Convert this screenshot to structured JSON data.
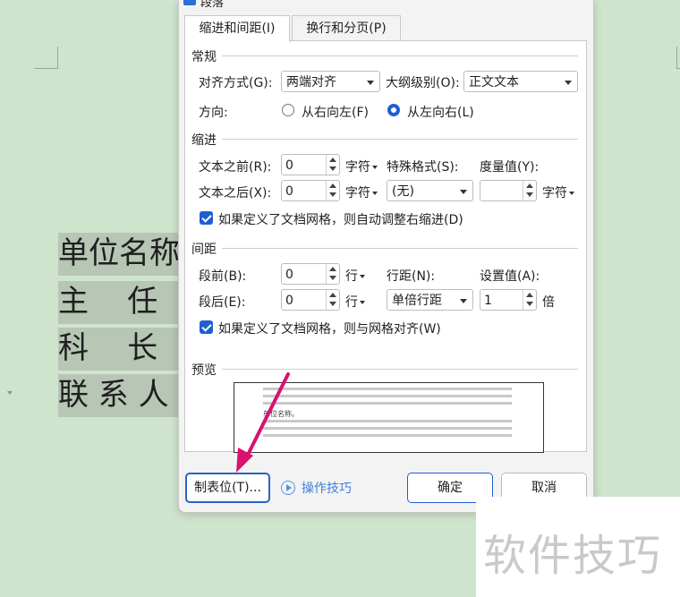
{
  "document": {
    "lines": [
      "单位名称",
      "主    任",
      "科    长",
      "联 系 人"
    ]
  },
  "dialog": {
    "title": "段落",
    "tabs": [
      "缩进和间距(I)",
      "换行和分页(P)"
    ],
    "general": {
      "section": "常规",
      "align_label": "对齐方式(G):",
      "align_value": "两端对齐",
      "outline_label": "大纲级别(O):",
      "outline_value": "正文文本",
      "direction_label": "方向:",
      "rtl_label": "从右向左(F)",
      "ltr_label": "从左向右(L)"
    },
    "indent": {
      "section": "缩进",
      "before_label": "文本之前(R):",
      "before_value": "0",
      "before_unit": "字符",
      "after_label": "文本之后(X):",
      "after_value": "0",
      "after_unit": "字符",
      "special_label": "特殊格式(S):",
      "special_value": "(无)",
      "measure_label": "度量值(Y):",
      "measure_value": "",
      "measure_unit": "字符",
      "grid_check": "如果定义了文档网格，则自动调整右缩进(D)"
    },
    "spacing": {
      "section": "间距",
      "before_label": "段前(B):",
      "before_value": "0",
      "before_unit": "行",
      "after_label": "段后(E):",
      "after_value": "0",
      "after_unit": "行",
      "line_label": "行距(N):",
      "line_value": "单倍行距",
      "setting_label": "设置值(A):",
      "setting_value": "1",
      "setting_unit": "倍",
      "grid_check": "如果定义了文档网格，则与网格对齐(W)"
    },
    "preview": {
      "section": "预览",
      "sample": "单位名称。"
    },
    "buttons": {
      "tabs_button": "制表位(T)...",
      "tips": "操作技巧",
      "ok": "确定",
      "cancel": "取消"
    }
  },
  "watermark": "软件技巧",
  "colors": {
    "accent": "#1e5fd1",
    "arrow": "#d8126e",
    "background": "#cfe4cd"
  }
}
